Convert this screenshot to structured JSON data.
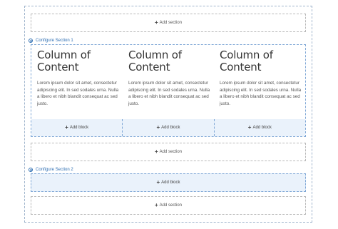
{
  "add_section_label": "Add section",
  "add_block_label": "Add block",
  "section1": {
    "configure_label": "Configure Section 1",
    "columns": [
      {
        "title": "Column of Content",
        "text": "Lorem ipsum dolor sit amet, consectetur adipiscing elit. In sed sodales urna. Nulla a libero et nibh blandit consequat ac sed justo."
      },
      {
        "title": "Column of Content",
        "text": "Lorem ipsum dolor sit amet, consectetur adipiscing elit. In sed sodales urna. Nulla a libero et nibh blandit consequat ac sed justo."
      },
      {
        "title": "Column of Content",
        "text": "Lorem ipsum dolor sit amet, consectetur adipiscing elit. In sed sodales urna. Nulla a libero et nibh blandit consequat ac sed justo."
      }
    ]
  },
  "section2": {
    "configure_label": "Configure Section 2"
  },
  "colors": {
    "accent": "#2f6fb3",
    "block_bg": "#eaf2fb",
    "dashed_border": "#7fa7d6"
  },
  "icons": {
    "close": "close-icon",
    "plus": "plus-icon"
  }
}
